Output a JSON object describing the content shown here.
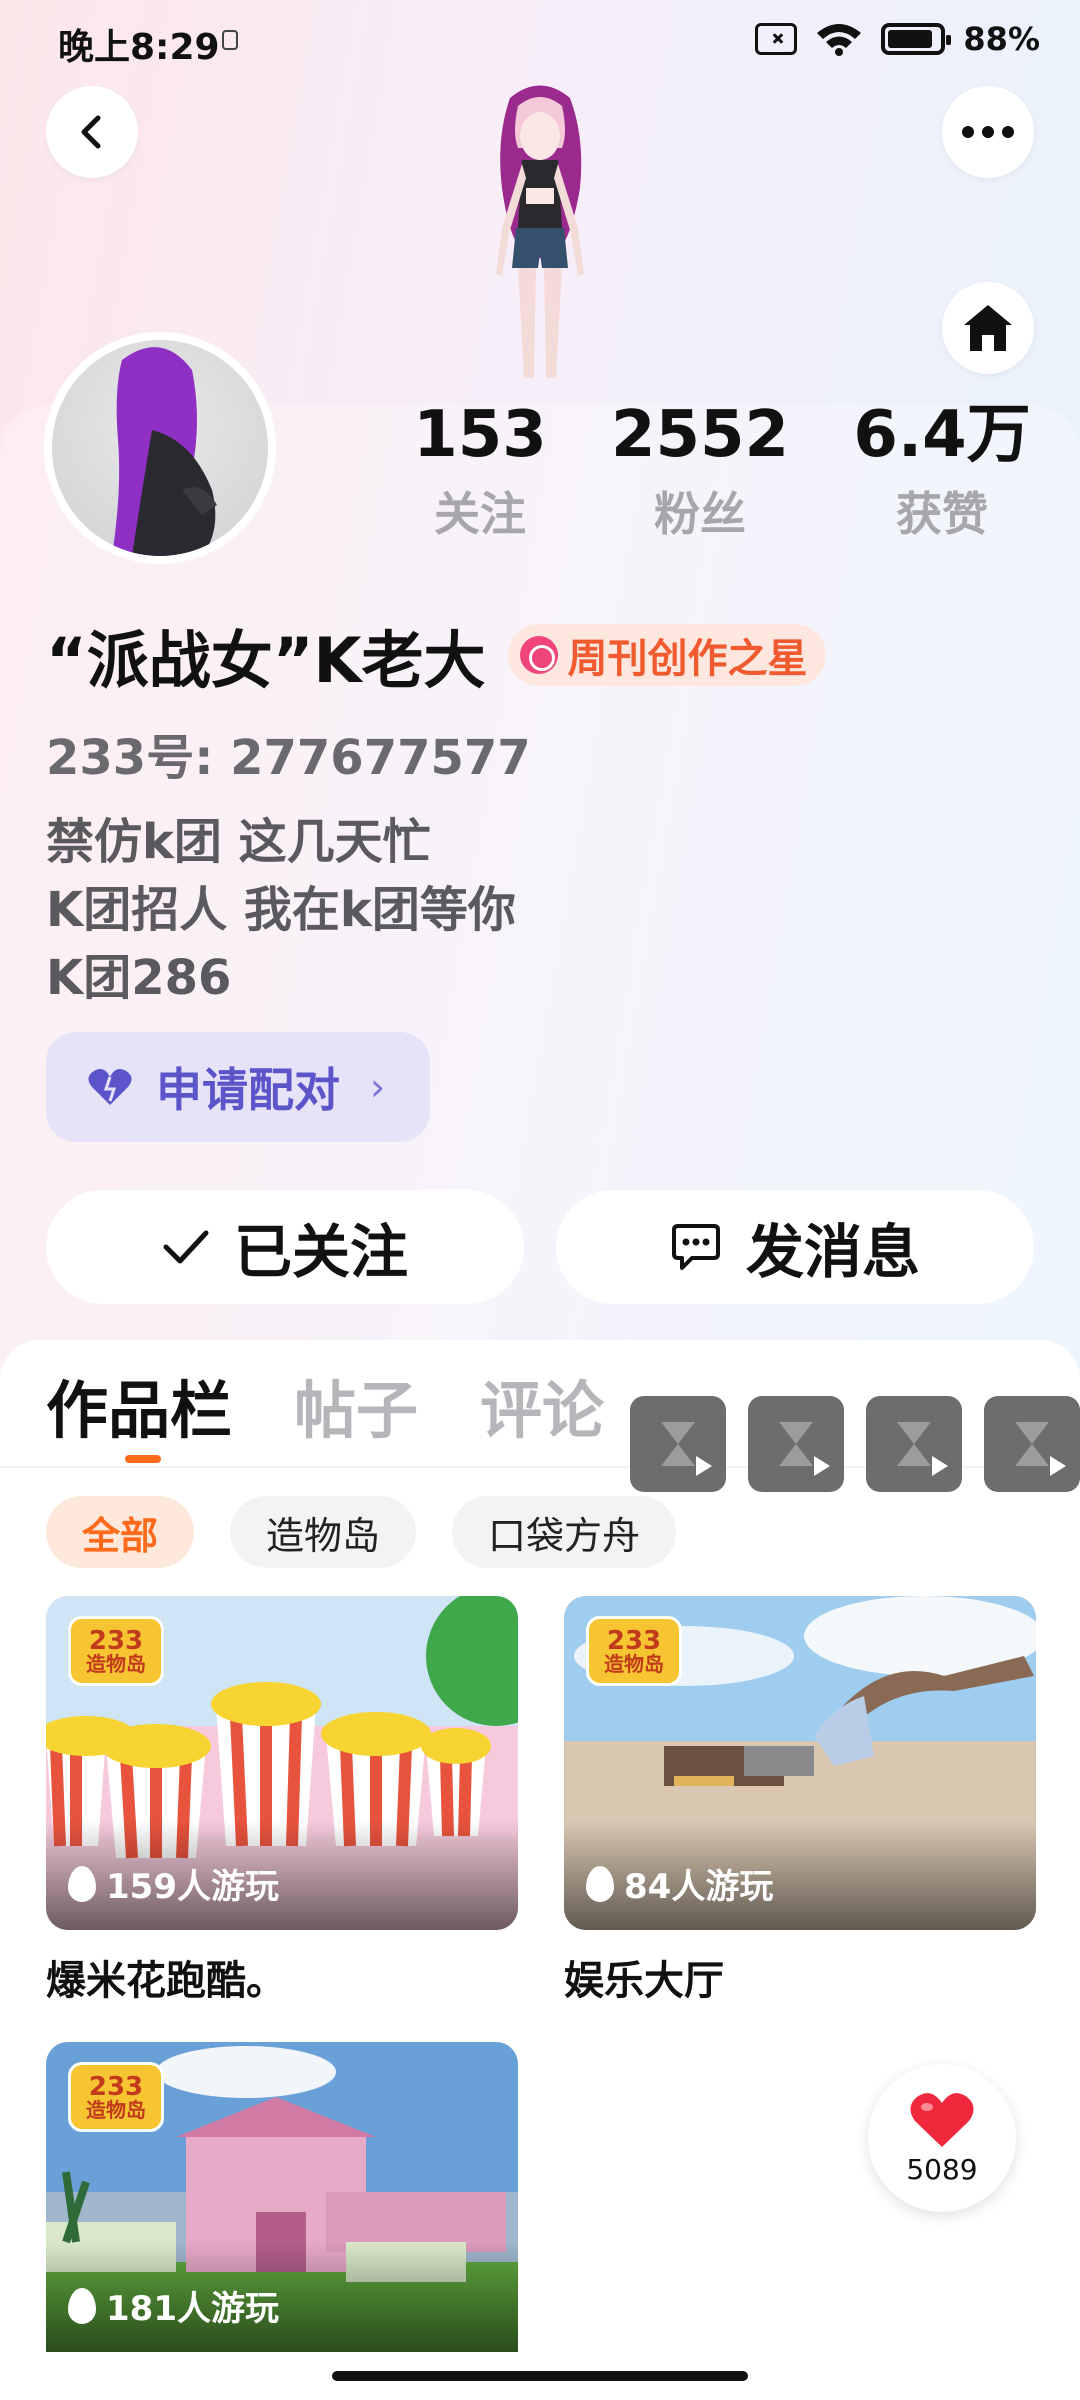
{
  "status_bar": {
    "time": "晚上8:29",
    "battery": "88%",
    "battery_level": 0.88
  },
  "header": {
    "back_icon": "chevron-left-icon",
    "more_icon": "more-horizontal-icon",
    "home_icon": "home-icon"
  },
  "profile": {
    "stats": [
      {
        "value": "153",
        "label": "关注"
      },
      {
        "value": "2552",
        "label": "粉丝"
      },
      {
        "value": "6.4万",
        "label": "获赞"
      }
    ],
    "name": "“派战女”K老大",
    "badge": "周刊创作之星",
    "uid": "233号: 277677577",
    "bio": [
      "禁仿k团 这几天忙",
      "K团招人 我在k团等你",
      "K团286"
    ],
    "pair_button": "申请配对",
    "followed_button": "已关注",
    "message_button": "发消息"
  },
  "tabs": [
    {
      "label": "作品栏",
      "active": true
    },
    {
      "label": "帖子",
      "active": false
    },
    {
      "label": "评论",
      "active": false
    }
  ],
  "filters": [
    {
      "label": "全部",
      "active": true
    },
    {
      "label": "造物岛",
      "active": false
    },
    {
      "label": "口袋方舟",
      "active": false
    }
  ],
  "works": [
    {
      "plays": "159人游玩",
      "title": "爆米花跑酷。",
      "logo_top": "233",
      "logo_bottom": "造物岛"
    },
    {
      "plays": "84人游玩",
      "title": "娱乐大厅",
      "logo_top": "233",
      "logo_bottom": "造物岛"
    },
    {
      "plays": "181人游玩",
      "title": "",
      "logo_top": "233",
      "logo_bottom": "造物岛"
    }
  ],
  "like_fab": {
    "count": "5089"
  },
  "colors": {
    "accent": "#ff6b1a",
    "pair": "#5b55c9",
    "badge": "#f05a2e"
  }
}
